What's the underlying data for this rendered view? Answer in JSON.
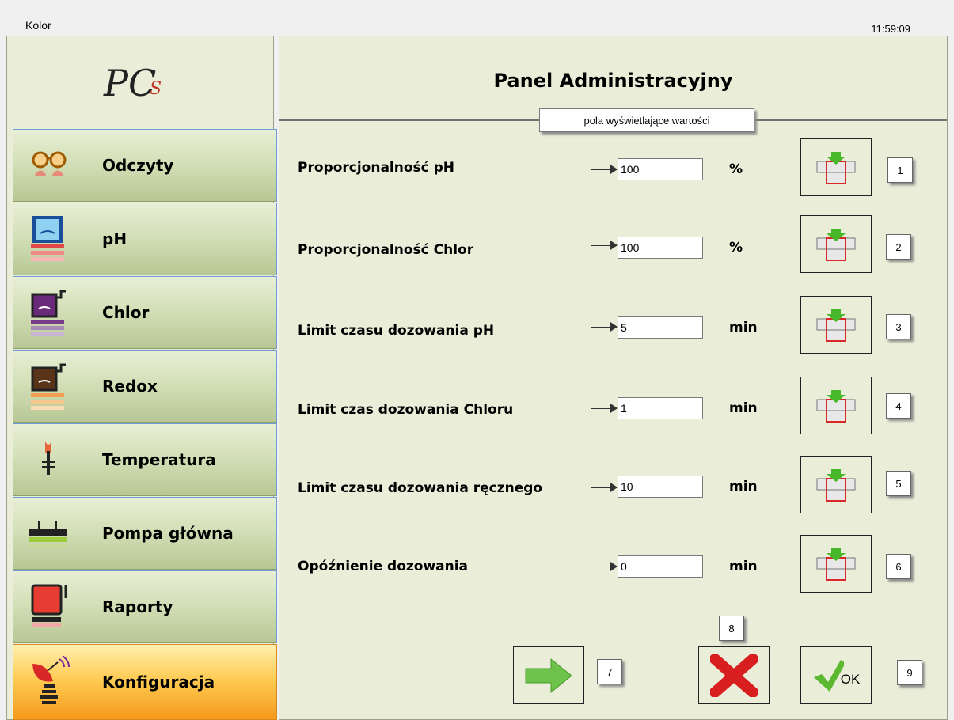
{
  "window": {
    "title": "Kolor",
    "clock": "11:59:09"
  },
  "logo": {
    "text": "PC",
    "accent": "S"
  },
  "sidebar": {
    "items": [
      {
        "label": "Odczyty",
        "icon": "glasses-icon"
      },
      {
        "label": "pH",
        "icon": "ph-beaker-icon"
      },
      {
        "label": "Chlor",
        "icon": "chlor-tank-icon"
      },
      {
        "label": "Redox",
        "icon": "redox-tank-icon"
      },
      {
        "label": "Temperatura",
        "icon": "thermometer-icon"
      },
      {
        "label": "Pompa główna",
        "icon": "pump-icon"
      },
      {
        "label": "Raporty",
        "icon": "report-icon"
      },
      {
        "label": "Konfiguracja",
        "icon": "satellite-icon"
      }
    ],
    "active_index": 7
  },
  "panel": {
    "title": "Panel Administracyjny",
    "callout": "pola wyświetlające wartości",
    "params": [
      {
        "label": "Proporcjonalność pH",
        "value": "100",
        "unit": "%",
        "num": "1"
      },
      {
        "label": "Proporcjonalność Chlor",
        "value": "100",
        "unit": "%",
        "num": "2"
      },
      {
        "label": "Limit czasu dozowania pH",
        "value": "5",
        "unit": "min",
        "num": "3"
      },
      {
        "label": "Limit czas dozowania Chloru",
        "value": "1",
        "unit": "min",
        "num": "4"
      },
      {
        "label": "Limit czasu dozowania ręcznego",
        "value": "10",
        "unit": "min",
        "num": "5"
      },
      {
        "label": "Opóźnienie dozowania",
        "value": "0",
        "unit": "min",
        "num": "6"
      }
    ],
    "buttons": {
      "next_num": "7",
      "cancel_num": "8",
      "ok_label": "OK",
      "ok_num": "9"
    }
  },
  "colors": {
    "panel_bg": "#eaeed9",
    "nav_active": "#f59a1c",
    "ok_green": "#5cb82e",
    "cancel_red": "#d81e1e",
    "arrow_green": "#6cc24a"
  }
}
